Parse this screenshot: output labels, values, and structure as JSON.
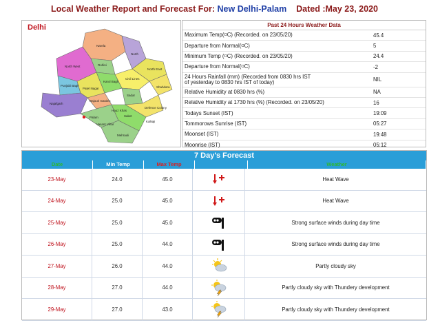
{
  "header": {
    "prefix": "Local Weather Report and Forecast For:",
    "location": "New Delhi-Palam",
    "dated": "Dated :May 23, 2020"
  },
  "map": {
    "title": "Delhi",
    "labels": [
      "Narela",
      "North West",
      "North",
      "Rohini",
      "Shahdara",
      "Civil Lines",
      "North East",
      "Karol Bagh",
      "Sadar",
      "Punjabi Bagh",
      "Patel Nagar",
      "Rajouri Garden",
      "Najafgarh",
      "Palam",
      "Vasant Vihar",
      "Defence Colony",
      "Mehrauli",
      "Saket",
      "Kalkaji",
      "Hauz Khas"
    ],
    "colors": [
      "#f4b083",
      "#e06bd0",
      "#9a7fd1",
      "#9bd18a",
      "#e9e35e",
      "#f3e36a",
      "#b8a4d9",
      "#7bc6e0",
      "#f7ef6a",
      "#8fdc6b"
    ]
  },
  "past24": {
    "title": "Past 24 Hours Weather Data",
    "rows": [
      {
        "label": "Maximum Temp(",
        "unit": "O",
        "label2": "C) (Recorded. on 23/05/20)",
        "value": "45.4"
      },
      {
        "label": "Departure from Normal(",
        "unit": "O",
        "label2": "C)",
        "value": "5"
      },
      {
        "label": "Minimum Temp (",
        "unit": "O",
        "label2": "C) (Recorded. on 23/05/20)",
        "value": "24.4"
      },
      {
        "label": "Departure from Normal(",
        "unit": "O",
        "label2": "C)",
        "value": "-2"
      },
      {
        "label": "24 Hours Rainfall (mm) (Recorded from 0830 hrs IST",
        "unit": "",
        "label2": "of yesterday to 0830 hrs IST of today)",
        "value": "NIL",
        "double": true
      },
      {
        "label": "Relative Humidity at 0830 hrs (%)",
        "unit": "",
        "label2": "",
        "value": "NA"
      },
      {
        "label": "Relative Humidity at 1730 hrs (%) (Recorded. on 23/05/20)",
        "unit": "",
        "label2": "",
        "value": "16"
      },
      {
        "label": "Todays Sunset (IST)",
        "unit": "",
        "label2": "",
        "value": "19:09"
      },
      {
        "label": "Tommorows Sunrise (IST)",
        "unit": "",
        "label2": "",
        "value": "05:27"
      },
      {
        "label": "Moonset (IST)",
        "unit": "",
        "label2": "",
        "value": "19:48"
      },
      {
        "label": "Moonrise (IST)",
        "unit": "",
        "label2": "",
        "value": "05:12"
      }
    ]
  },
  "forecast": {
    "title": "7 Day's Forecast",
    "headers": {
      "date": "Date",
      "min": "Min Temp",
      "max": "Max Temp",
      "weather": "Weather"
    },
    "rows": [
      {
        "date": "23-May",
        "min": "24.0",
        "max": "45.0",
        "icon": "heat-wave-icon",
        "weather": "Heat Wave"
      },
      {
        "date": "24-May",
        "min": "25.0",
        "max": "45.0",
        "icon": "heat-wave-icon",
        "weather": "Heat Wave"
      },
      {
        "date": "25-May",
        "min": "25.0",
        "max": "45.0",
        "icon": "strong-wind-icon",
        "weather": "Strong surface winds during day time"
      },
      {
        "date": "26-May",
        "min": "25.0",
        "max": "44.0",
        "icon": "strong-wind-icon",
        "weather": "Strong surface winds during day time"
      },
      {
        "date": "27-May",
        "min": "26.0",
        "max": "44.0",
        "icon": "partly-cloudy-icon",
        "weather": "Partly cloudy sky"
      },
      {
        "date": "28-May",
        "min": "27.0",
        "max": "44.0",
        "icon": "thundery-icon",
        "weather": "Partly cloudy sky with Thundery development"
      },
      {
        "date": "29-May",
        "min": "27.0",
        "max": "43.0",
        "icon": "thundery-icon",
        "weather": "Partly cloudy sky with Thundery development"
      }
    ]
  }
}
